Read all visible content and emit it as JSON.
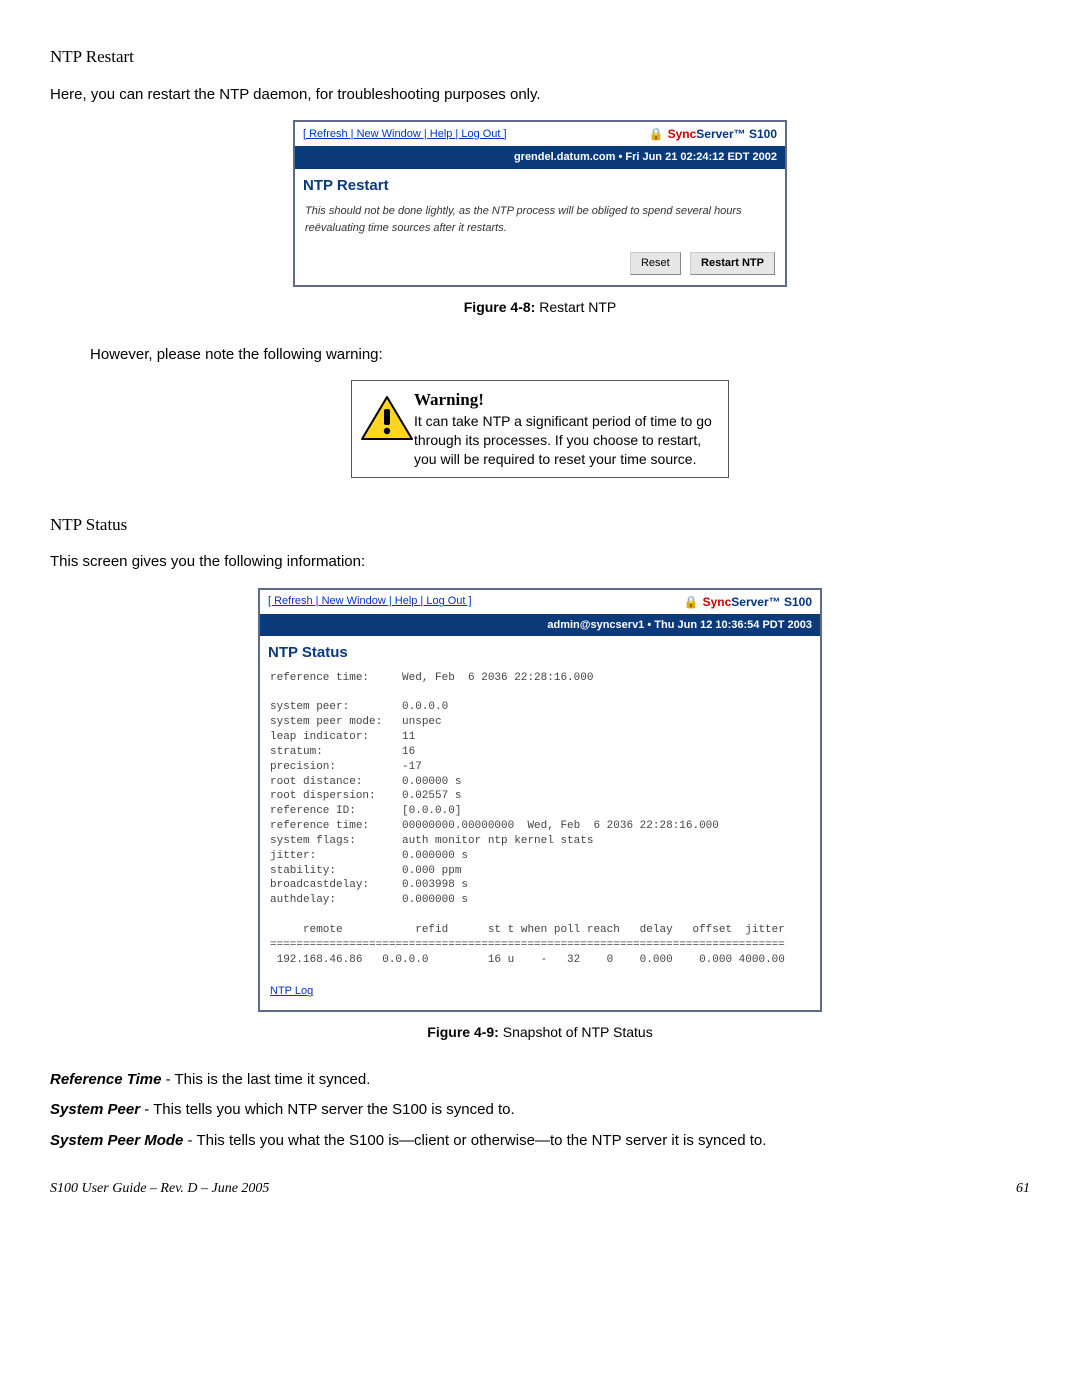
{
  "sections": {
    "restart_heading": "NTP Restart",
    "restart_intro": "Here, you can restart the NTP daemon, for troubleshooting purposes only.",
    "restart_caption_prefix": "Figure 4-8:  ",
    "restart_caption": "Restart NTP",
    "warning_intro": "However, please note the following warning:",
    "status_heading": "NTP Status",
    "status_intro": "This screen gives you the following information:",
    "status_caption_prefix": "Figure 4-9:  ",
    "status_caption": "Snapshot of NTP Status"
  },
  "screenshot_restart": {
    "links_text": "[ Refresh | New Window | Help | Log Out ]",
    "brand_sync": "Sync",
    "brand_server": "Server™ ",
    "brand_model": "S100",
    "bluebar": "grendel.datum.com  •  Fri Jun 21 02:24:12 EDT 2002",
    "title": "NTP Restart",
    "note": "This should not be done lightly, as the NTP process will be obliged to spend several hours reëvaluating time sources after it restarts.",
    "btn_reset": "Reset",
    "btn_restart": "Restart NTP"
  },
  "warning": {
    "title": "Warning!",
    "body": "It can take NTP a significant period of time to go through its processes. If you choose to restart, you will be required to reset your time source."
  },
  "screenshot_status": {
    "links_text": "[ Refresh | New Window | Help | Log Out ]",
    "brand_sync": "Sync",
    "brand_server": "Server™ ",
    "brand_model": "S100",
    "bluebar": "admin@syncserv1  •  Thu Jun 12 10:36:54 PDT 2003",
    "title": "NTP Status",
    "mono": "reference time:     Wed, Feb  6 2036 22:28:16.000\n\nsystem peer:        0.0.0.0\nsystem peer mode:   unspec\nleap indicator:     11\nstratum:            16\nprecision:          -17\nroot distance:      0.00000 s\nroot dispersion:    0.02557 s\nreference ID:       [0.0.0.0]\nreference time:     00000000.00000000  Wed, Feb  6 2036 22:28:16.000\nsystem flags:       auth monitor ntp kernel stats\njitter:             0.000000 s\nstability:          0.000 ppm\nbroadcastdelay:     0.003998 s\nauthdelay:          0.000000 s\n\n     remote           refid      st t when poll reach   delay   offset  jitter\n==============================================================================\n 192.168.46.86   0.0.0.0         16 u    -   32    0    0.000    0.000 4000.00",
    "log_link": "NTP Log"
  },
  "definitions": {
    "ref_time_label": "Reference Time",
    "ref_time_text": " - This is the last time it synced.",
    "sys_peer_label": "System Peer",
    "sys_peer_text": " - This tells you which NTP server the S100 is synced to.",
    "sys_peer_mode_label": "System Peer Mode",
    "sys_peer_mode_text": " - This tells you what the S100 is—client or otherwise—to the NTP server it is synced to."
  },
  "footer": {
    "left": "S100 User Guide – Rev. D – June 2005",
    "right": "61"
  }
}
